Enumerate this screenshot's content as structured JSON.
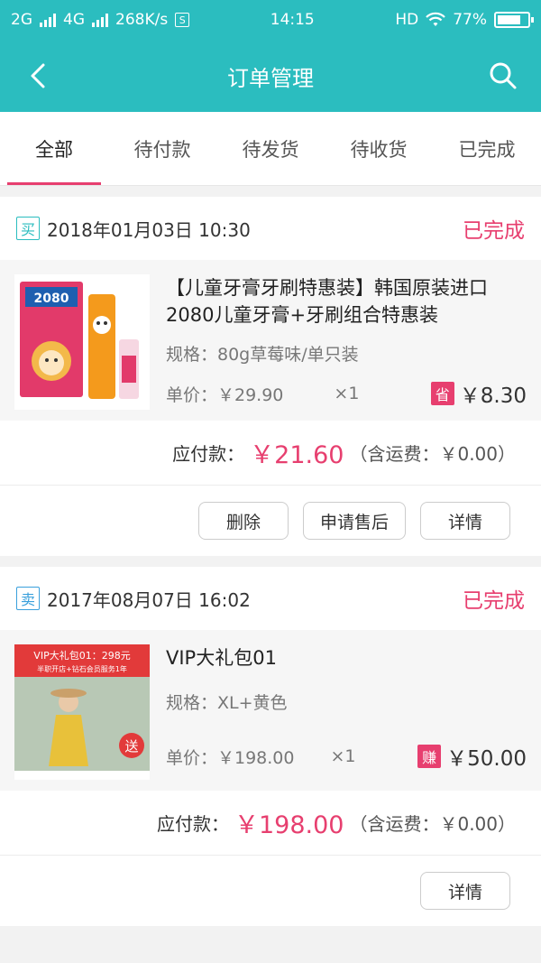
{
  "status_bar": {
    "net1": "2G",
    "net2": "4G",
    "speed": "268K/s",
    "s_icon": "S",
    "time": "14:15",
    "hd": "HD",
    "battery": "77%"
  },
  "header": {
    "title": "订单管理"
  },
  "tabs": [
    {
      "label": "全部"
    },
    {
      "label": "待付款"
    },
    {
      "label": "待发货"
    },
    {
      "label": "待收货"
    },
    {
      "label": "已完成"
    }
  ],
  "orders": [
    {
      "tag": "买",
      "datetime": "2018年01月03日 10:30",
      "status": "已完成",
      "product_name": "【儿童牙膏牙刷特惠装】韩国原装进口 2080儿童牙膏+牙刷组合特惠装",
      "spec": "规格：80g草莓味/单只装",
      "unit_price": "单价：￥29.90",
      "qty": "×1",
      "extra_tag": "省",
      "extra_amount": "￥8.30",
      "pay_label": "应付款：",
      "pay_amount": "￥21.60",
      "shipping": "（含运费：￥0.00）",
      "thumb_text": "2080",
      "buttons": [
        "删除",
        "申请售后",
        "详情"
      ]
    },
    {
      "tag": "卖",
      "datetime": "2017年08月07日 16:02",
      "status": "已完成",
      "product_name": "VIP大礼包01",
      "spec": "规格：XL+黄色",
      "unit_price": "单价：￥198.00",
      "qty": "×1",
      "extra_tag": "赚",
      "extra_amount": "￥50.00",
      "pay_label": "应付款：",
      "pay_amount": "￥198.00",
      "shipping": "（含运费：￥0.00）",
      "thumb_title": "VIP大礼包01：298元",
      "thumb_sub": "半职开店+钻石会员服务1年",
      "thumb_badge": "送",
      "buttons": [
        "详情"
      ]
    }
  ]
}
